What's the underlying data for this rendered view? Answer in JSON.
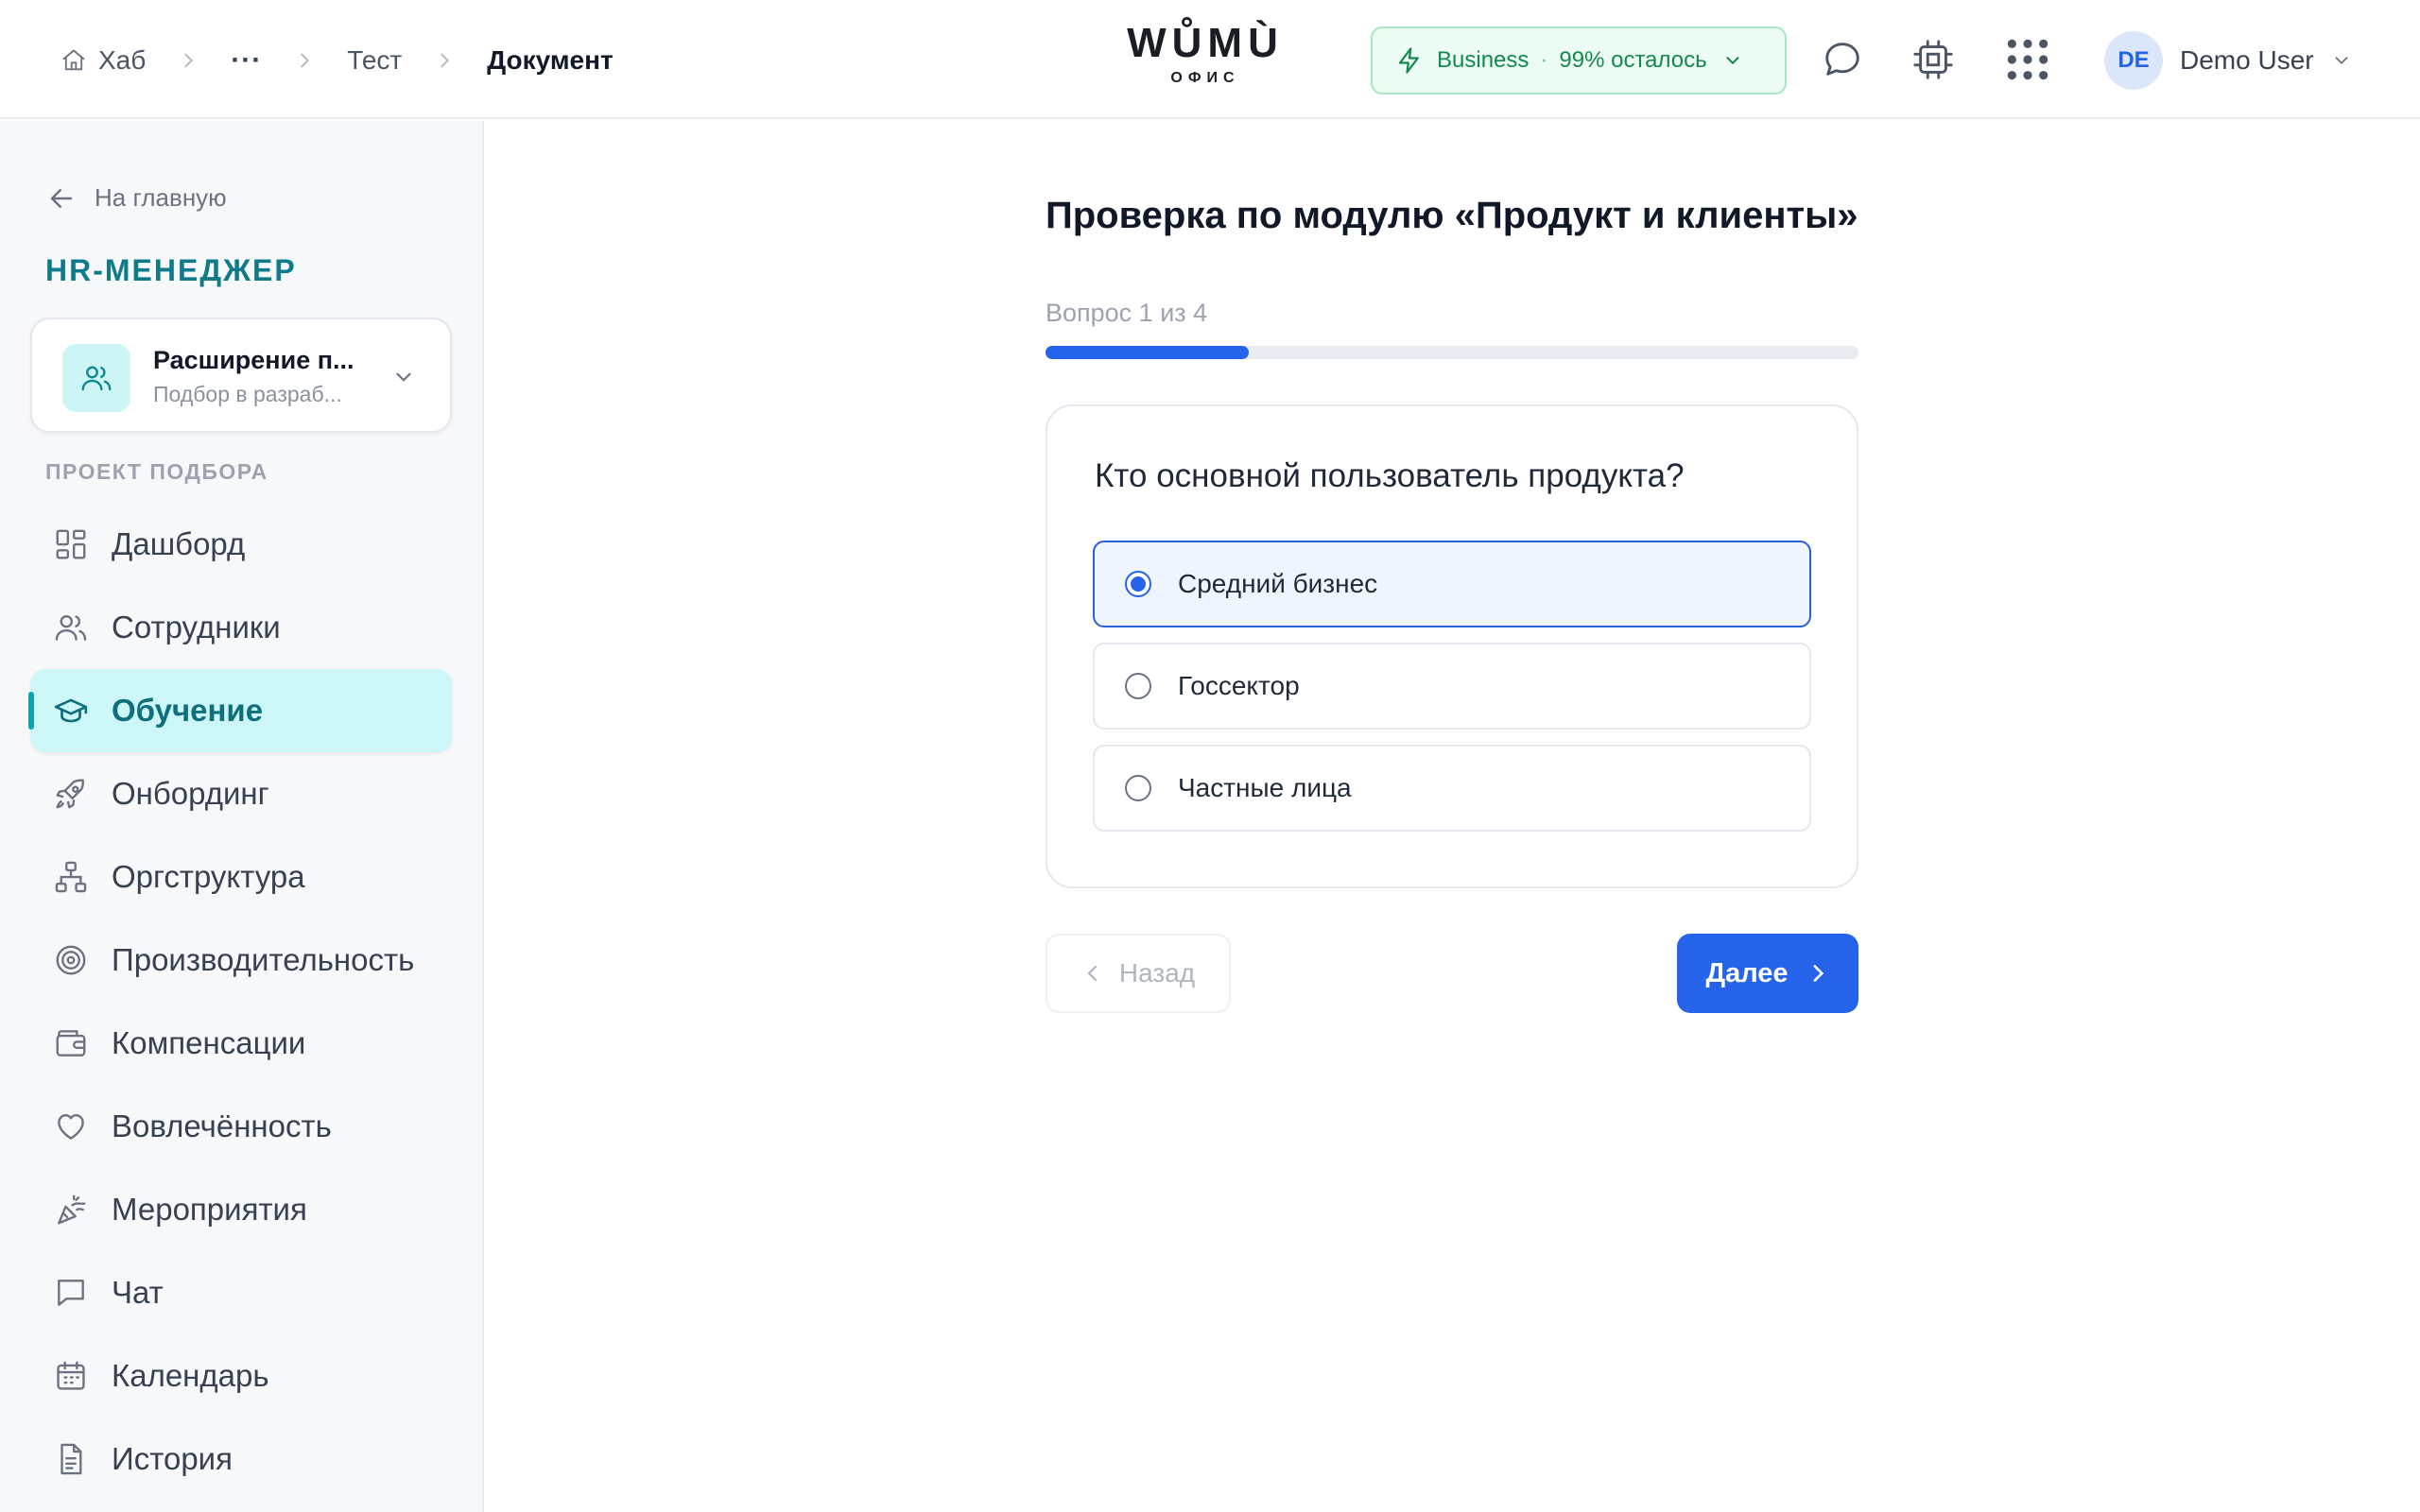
{
  "header": {
    "breadcrumb": {
      "home": "Хаб",
      "ellipsis": "···",
      "items": [
        "Тест",
        "Документ"
      ]
    },
    "logo": {
      "main": "WŮMÙ",
      "sub": "ОФИС"
    },
    "plan": {
      "name": "Business",
      "separator": "·",
      "remaining": "99% осталось"
    },
    "user": {
      "initials": "DE",
      "name": "Demo User"
    }
  },
  "sidebar": {
    "back_label": "На главную",
    "role_title": "HR-МЕНЕДЖЕР",
    "project": {
      "title": "Расширение п...",
      "subtitle": "Подбор в разраб..."
    },
    "section_label": "ПРОЕКТ ПОДБОРА",
    "items": [
      {
        "label": "Дашборд",
        "icon": "dashboard-icon",
        "active": false
      },
      {
        "label": "Сотрудники",
        "icon": "users-icon",
        "active": false
      },
      {
        "label": "Обучение",
        "icon": "graduation-cap-icon",
        "active": true
      },
      {
        "label": "Онбординг",
        "icon": "rocket-icon",
        "active": false
      },
      {
        "label": "Оргструктура",
        "icon": "org-chart-icon",
        "active": false
      },
      {
        "label": "Производительность",
        "icon": "target-icon",
        "active": false
      },
      {
        "label": "Компенсации",
        "icon": "wallet-icon",
        "active": false
      },
      {
        "label": "Вовлечённость",
        "icon": "heart-icon",
        "active": false
      },
      {
        "label": "Мероприятия",
        "icon": "party-popper-icon",
        "active": false
      },
      {
        "label": "Чат",
        "icon": "chat-icon",
        "active": false
      },
      {
        "label": "Календарь",
        "icon": "calendar-icon",
        "active": false
      },
      {
        "label": "История",
        "icon": "document-icon",
        "active": false
      }
    ]
  },
  "quiz": {
    "title": "Проверка по модулю «Продукт и клиенты»",
    "progress_label": "Вопрос 1 из 4",
    "progress_fraction": 0.25,
    "question": "Кто основной пользователь продукта?",
    "options": [
      {
        "label": "Средний бизнес",
        "selected": true
      },
      {
        "label": "Госсектор",
        "selected": false
      },
      {
        "label": "Частные лица",
        "selected": false
      }
    ],
    "back_label": "Назад",
    "next_label": "Далее"
  },
  "colors": {
    "accent": "#2563eb",
    "brand_teal": "#0f7b8a",
    "plan_green": "#138a4d"
  }
}
